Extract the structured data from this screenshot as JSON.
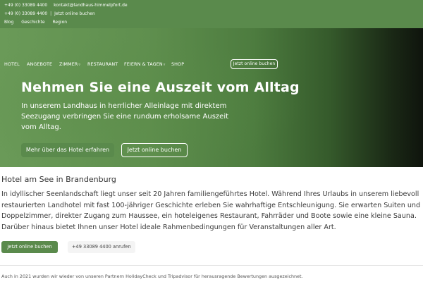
{
  "topbar": {
    "phone": "+49 (0) 33089 4400",
    "email": "kontakt@landhaus-himmelpfort.de",
    "phone2": "+49 (0) 33089 4400",
    "separator": "|",
    "book_link": "Jetzt online buchen",
    "links": [
      "Blog",
      "Geschichte",
      "Region"
    ]
  },
  "nav": {
    "items": [
      "HOTEL",
      "ANGEBOTE",
      "ZIMMER",
      "RESTAURANT",
      "FEIERN & TAGEN",
      "SHOP"
    ],
    "book_button": "Jetzt online buchen"
  },
  "hero": {
    "title": "Nehmen Sie eine Auszeit vom Alltag",
    "text": "In unserem Landhaus in herrlicher Alleinlage mit direktem Seezugang verbringen Sie eine rundum erholsame Auszeit vom Alltag.",
    "primary_button": "Mehr über das Hotel erfahren",
    "secondary_button": "Jetzt online buchen"
  },
  "main": {
    "title": "Hotel am See in Brandenburg",
    "text": "In idyllischer Seenlandschaft liegt unser seit 20 Jahren familiengeführtes Hotel. Während Ihres Urlaubs in unserem liebevoll restaurierten Landhotel mit fast 100-jähriger Geschichte erleben Sie wahrhaftige Entschleunigung. Sie erwarten Suiten und Doppelzimmer, direkter Zugang zum Haussee, ein hoteleigenes Restaurant, Fahrräder und Boote sowie eine kleine Sauna. Darüber hinaus bietet Ihnen unser Hotel ideale Rahmenbedingungen für Veranstaltungen aller Art.",
    "book_button": "Jetzt online buchen",
    "phone_link": "+49 33089 4400 anrufen"
  },
  "footer": {
    "note": "Auch in 2021 wurden wir wieder von unseren Partnern HolidayCheck und Tripadvisor für herausragende Bewertungen ausgezeichnet."
  },
  "colors": {
    "brand_green": "#5a8a4c",
    "hero_dark": "#0f140d"
  }
}
